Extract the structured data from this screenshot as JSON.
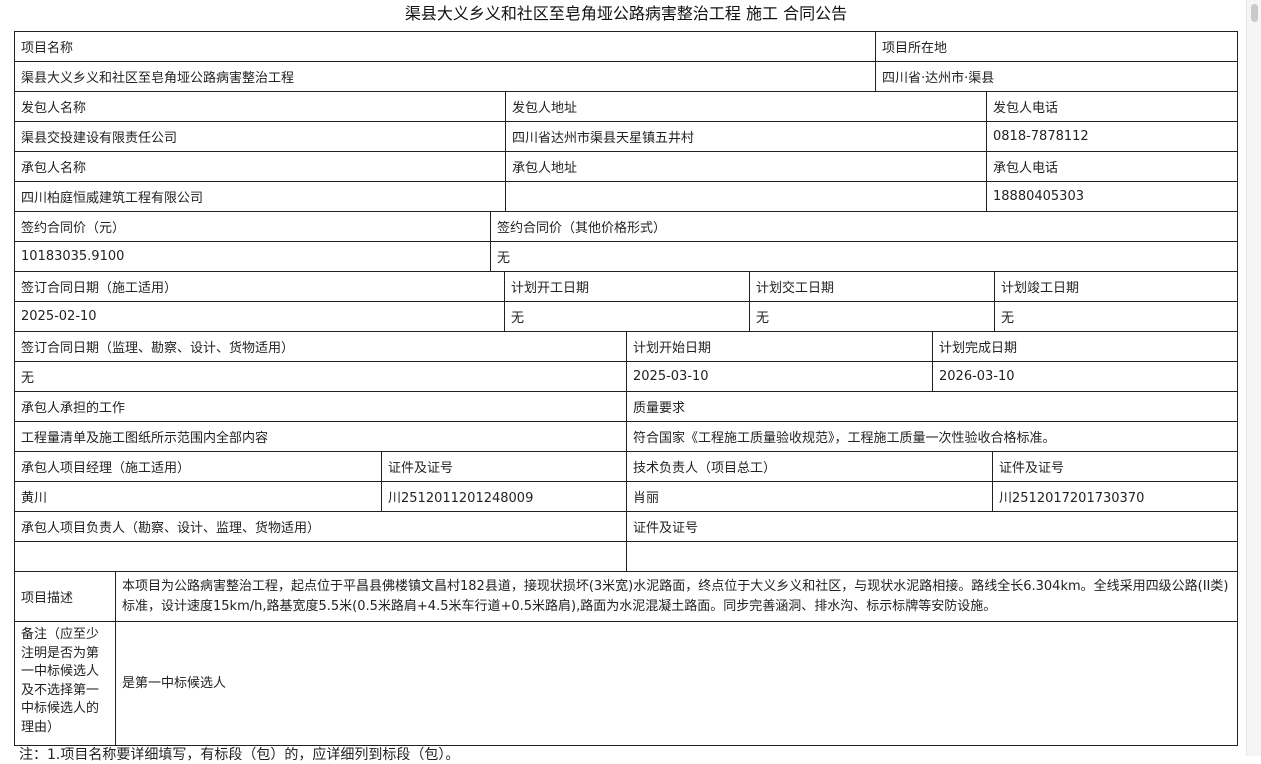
{
  "title": "渠县大义乡义和社区至皂角垭公路病害整治工程 施工 合同公告",
  "rows": [
    [
      {
        "text": "项目名称",
        "w": 861
      },
      {
        "text": "项目所在地",
        "w": 362
      }
    ],
    [
      {
        "text": "渠县大义乡义和社区至皂角垭公路病害整治工程",
        "w": 861
      },
      {
        "text": "四川省·达州市·渠县",
        "w": 362
      }
    ],
    [
      {
        "text": "发包人名称",
        "w": 491
      },
      {
        "text": "发包人地址",
        "w": 481
      },
      {
        "text": "发包人电话",
        "w": 251
      }
    ],
    [
      {
        "text": "渠县交投建设有限责任公司",
        "w": 491
      },
      {
        "text": "四川省达州市渠县天星镇五井村",
        "w": 481
      },
      {
        "text": "0818-7878112",
        "w": 251
      }
    ],
    [
      {
        "text": "承包人名称",
        "w": 491
      },
      {
        "text": "承包人地址",
        "w": 481
      },
      {
        "text": "承包人电话",
        "w": 251
      }
    ],
    [
      {
        "text": "四川柏庭恒威建筑工程有限公司",
        "w": 491
      },
      {
        "text": "",
        "w": 481
      },
      {
        "text": "18880405303",
        "w": 251
      }
    ],
    [
      {
        "text": "签约合同价（元）",
        "w": 476
      },
      {
        "text": "签约合同价（其他价格形式）",
        "w": 747
      }
    ],
    [
      {
        "text": "10183035.9100",
        "w": 476
      },
      {
        "text": "无",
        "w": 747
      }
    ],
    [
      {
        "text": "签订合同日期（施工适用）",
        "w": 490
      },
      {
        "text": "计划开工日期",
        "w": 245
      },
      {
        "text": "计划交工日期",
        "w": 245
      },
      {
        "text": "计划竣工日期",
        "w": 243
      }
    ],
    [
      {
        "text": "2025-02-10",
        "w": 490
      },
      {
        "text": "无",
        "w": 245
      },
      {
        "text": "无",
        "w": 245
      },
      {
        "text": "无",
        "w": 243
      }
    ],
    [
      {
        "text": "签订合同日期（监理、勘察、设计、货物适用）",
        "w": 612
      },
      {
        "text": "计划开始日期",
        "w": 306
      },
      {
        "text": "计划完成日期",
        "w": 305
      }
    ],
    [
      {
        "text": "无",
        "w": 612
      },
      {
        "text": "2025-03-10",
        "w": 306
      },
      {
        "text": "2026-03-10",
        "w": 305
      }
    ],
    [
      {
        "text": "承包人承担的工作",
        "w": 612
      },
      {
        "text": "质量要求",
        "w": 611
      }
    ],
    [
      {
        "text": "工程量清单及施工图纸所示范围内全部内容",
        "w": 612
      },
      {
        "text": "符合国家《工程施工质量验收规范》，工程施工质量一次性验收合格标准。",
        "w": 611
      }
    ],
    [
      {
        "text": "承包人项目经理（施工适用）",
        "w": 367
      },
      {
        "text": "证件及证号",
        "w": 245
      },
      {
        "text": "技术负责人（项目总工）",
        "w": 366
      },
      {
        "text": "证件及证号",
        "w": 245
      }
    ],
    [
      {
        "text": "黄川",
        "w": 367
      },
      {
        "text": "川2512011201248009",
        "w": 245
      },
      {
        "text": "肖丽",
        "w": 366
      },
      {
        "text": "川2512017201730370",
        "w": 245
      }
    ],
    [
      {
        "text": "承包人项目负责人（勘察、设计、监理、货物适用）",
        "w": 612
      },
      {
        "text": "证件及证号",
        "w": 611
      }
    ],
    [
      {
        "text": "",
        "w": 612
      },
      {
        "text": "",
        "w": 611
      }
    ]
  ],
  "description": {
    "label": "项目描述",
    "text": "本项目为公路病害整治工程，起点位于平昌县佛楼镇文昌村182县道，接现状损坏(3米宽)水泥路面，终点位于大义乡义和社区，与现状水泥路相接。路线全长6.304km。全线采用四级公路(II类)标准，设计速度15km/h,路基宽度5.5米(0.5米路肩+4.5米车行道+0.5米路肩),路面为水泥混凝土路面。同步完善涵洞、排水沟、标示标牌等安防设施。"
  },
  "remark": {
    "label": "备注（应至少注明是否为第一中标候选人及不选择第一中标候选人的理由）",
    "text": "是第一中标候选人"
  },
  "footnote": "注：1.项目名称要详细填写，有标段（包）的，应详细列到标段（包）。"
}
